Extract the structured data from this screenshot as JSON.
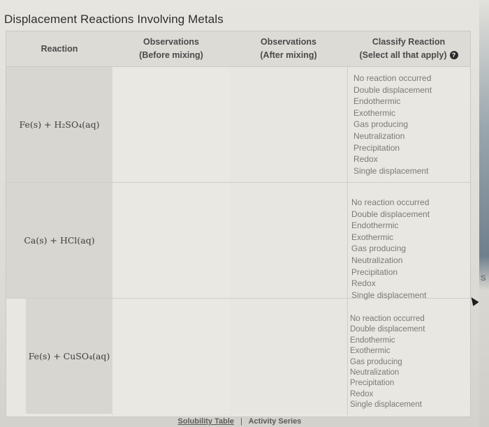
{
  "page": {
    "title": "Displacement Reactions Involving Metals"
  },
  "table": {
    "headers": {
      "reaction": "Reaction",
      "before_line1": "Observations",
      "before_line2": "(Before mixing)",
      "after_line1": "Observations",
      "after_line2": "(After mixing)",
      "classify_line1": "Classify Reaction",
      "classify_line2": "(Select all that apply)",
      "help_icon": "question-circle-icon",
      "help_glyph": "?"
    },
    "rows": [
      {
        "reaction": "Fe(s) + H₂SO₄(aq)",
        "observations_before": "",
        "observations_after": "",
        "options": [
          "No reaction occurred",
          "Double displacement",
          "Endothermic",
          "Exothermic",
          "Gas producing",
          "Neutralization",
          "Precipitation",
          "Redox",
          "Single displacement"
        ]
      },
      {
        "reaction": "Ca(s) + HCl(aq)",
        "observations_before": "",
        "observations_after": "",
        "options": [
          "No reaction occurred",
          "Double displacement",
          "Endothermic",
          "Exothermic",
          "Gas producing",
          "Neutralization",
          "Precipitation",
          "Redox",
          "Single displacement"
        ]
      },
      {
        "reaction": "Fe(s) + CuSO₄(aq)",
        "observations_before": "",
        "observations_after": "",
        "options": [
          "No reaction occurred",
          "Double displacement",
          "Endothermic",
          "Exothermic",
          "Gas producing",
          "Neutralization",
          "Precipitation",
          "Redox",
          "Single displacement"
        ]
      }
    ]
  },
  "footer": {
    "solubility_link": "Solubility Table",
    "separator": "|",
    "activity_link": "Activity Series"
  },
  "edge": {
    "side_letter": "S"
  }
}
